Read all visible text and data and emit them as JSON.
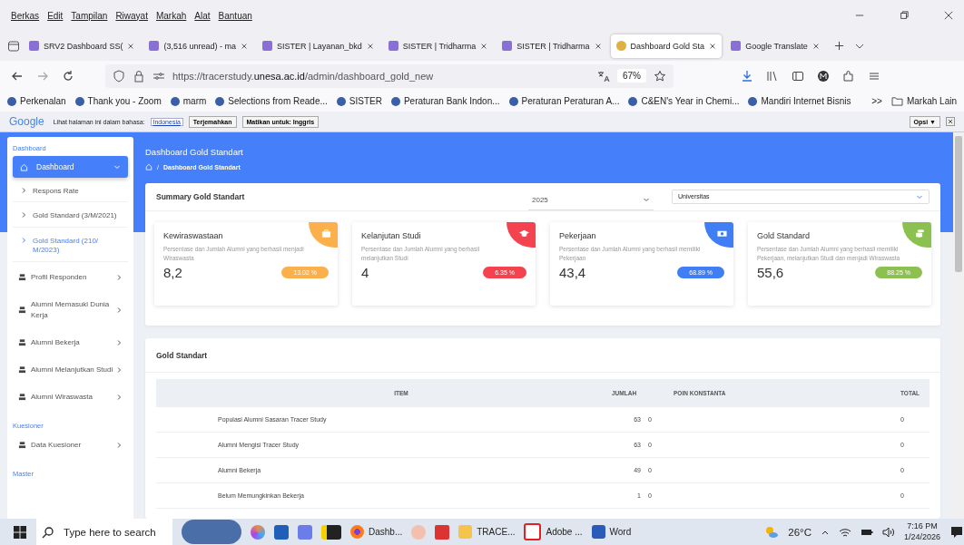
{
  "menu_bar": [
    "Berkas",
    "Edit",
    "Tampilan",
    "Riwayat",
    "Markah",
    "Alat",
    "Bantuan"
  ],
  "tabs": [
    {
      "label": "SRV2 Dashboard SS(",
      "selected": false
    },
    {
      "label": "(3,516 unread) - ma",
      "selected": false
    },
    {
      "label": "SISTER | Layanan_bkd",
      "selected": false
    },
    {
      "label": "SISTER | Tridharma",
      "selected": false
    },
    {
      "label": "SISTER | Tridharma",
      "selected": false
    },
    {
      "label": "Dashboard Gold Sta",
      "selected": true
    },
    {
      "label": "Google Translate",
      "selected": false
    }
  ],
  "address_bar": {
    "url": "https://tracerstudy.**unesa.ac.id**/admin/dashboard_gold_new",
    "zoom": "67%"
  },
  "bookmarks": [
    "Perkenalan",
    "Thank you - Zoom",
    "marm",
    "Selections from Reade...",
    "SISTER",
    "Peraturan Bank Indon...",
    "Peraturan Peraturan A...",
    "C&EN's Year in Chemi...",
    "Mandiri Internet Bisnis"
  ],
  "bookmarks_more": ">>",
  "bookmarks_other": "Markah Lain",
  "translate_bar": {
    "logo": "Google",
    "prompt": "Lihat halaman ini dalam bahasa:",
    "language": "Indonesia",
    "translate": "Terjemahkan",
    "disable": "Matikan untuk: Inggris",
    "options": "Opsi ▼"
  },
  "sidebar": {
    "sections": [
      {
        "title": "Dashboard",
        "items": [
          {
            "label": "Dashboard",
            "kind": "main",
            "selected": true,
            "children": [
              {
                "label": "Respons Rate",
                "selected": false
              },
              {
                "label": "Gold Standard (3/M/2021)",
                "selected": false
              },
              {
                "label": "Gold Standard (210/ M/2023)",
                "selected": true
              }
            ]
          },
          {
            "label": "Profil Responden",
            "kind": "item",
            "selected": false
          },
          {
            "label": "Alumni Memasuki Dunia Kerja",
            "kind": "item",
            "selected": false
          },
          {
            "label": "Alumni Bekerja",
            "kind": "item",
            "selected": false
          },
          {
            "label": "Alumni Melanjutkan Studi",
            "kind": "item",
            "selected": false
          },
          {
            "label": "Alumni Wiraswasta",
            "kind": "item",
            "selected": false
          }
        ]
      },
      {
        "title": "Kuesioner",
        "items": [
          {
            "label": "Data Kuesioner",
            "kind": "item",
            "selected": false
          }
        ]
      },
      {
        "title": "Master"
      }
    ]
  },
  "header": {
    "title": "Dashboard Gold Standart",
    "separator": "/",
    "breadcrumb": "Dashboard Gold Standart"
  },
  "summary": {
    "title": "Summary Gold Standart",
    "year": "2025",
    "scope": "Universitas",
    "cards": [
      {
        "title": "Kewiraswastaan",
        "description": "Persentase dan Jumlah Alumni yang berhasil menjadi Wiraswasta",
        "value": "8,2",
        "percent": "13.02 %",
        "color": "#fbb04b",
        "kind": "briefcase"
      },
      {
        "title": "Kelanjutan Studi",
        "description": "Persentase dan Jumlah Alumni yang berhasil melanjutkan Studi",
        "value": "4",
        "percent": "6.35 %",
        "color": "#f5424f",
        "kind": "cap"
      },
      {
        "title": "Pekerjaan",
        "description": "Persentase dan Jumlah Alumni yang berhasil memiliki Pekerjaan",
        "value": "43,4",
        "percent": "68.89 %",
        "color": "#3f7ef5",
        "kind": "money"
      },
      {
        "title": "Gold Standard",
        "description": "Persentase dan Jumlah Alumni yang berhasil memiliki Pekerjaan, melanjutkan Studi dan menjadi Wiraswasta",
        "value": "55,6",
        "percent": "88.25 %",
        "color": "#8cc152",
        "kind": "coins"
      }
    ]
  },
  "gold_table": {
    "title": "Gold Standart",
    "columns": [
      "ITEM",
      "JUMLAH",
      "POIN KONSTANTA",
      "TOTAL"
    ],
    "rows": [
      [
        "Populasi Alumni Sasaran Tracer Study",
        "63",
        "0",
        "0"
      ],
      [
        "Alumni Mengisi Tracer Study",
        "63",
        "0",
        "0"
      ],
      [
        "Alumni Bekerja",
        "49",
        "0",
        "0"
      ],
      [
        "Belum Memungkinkan Bekerja",
        "1",
        "0",
        "0"
      ]
    ]
  },
  "taskbar": {
    "search": "Type here to search",
    "apps": [
      {
        "label": "Dashb...",
        "kind": "firefox"
      },
      {
        "label": "TRACE...",
        "kind": "folder"
      },
      {
        "label": "Adobe ...",
        "kind": "pdf"
      },
      {
        "label": "Word",
        "kind": "word"
      }
    ],
    "weather": "26°C",
    "time": "7:16 PM",
    "date": "1/24/2026"
  }
}
